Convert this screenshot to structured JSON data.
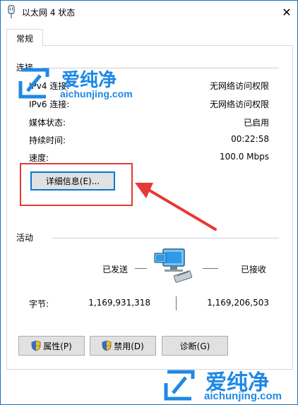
{
  "window": {
    "title": "以太网 4 状态",
    "close": "✕"
  },
  "tabs": [
    {
      "label": "常规"
    }
  ],
  "connection": {
    "section_label": "连接",
    "rows": [
      {
        "label": "IPv4 连接:",
        "value": "无网络访问权限"
      },
      {
        "label": "IPv6 连接:",
        "value": "无网络访问权限"
      },
      {
        "label": "媒体状态:",
        "value": "已启用"
      },
      {
        "label": "持续时间:",
        "value": "00:22:58"
      },
      {
        "label": "速度:",
        "value": "100.0 Mbps"
      }
    ],
    "details_button": "详细信息(E)..."
  },
  "activity": {
    "section_label": "活动",
    "sent_label": "已发送",
    "received_label": "已接收",
    "bytes_label": "字节:",
    "bytes_sent": "1,169,931,318",
    "bytes_received": "1,169,206,503"
  },
  "buttons": {
    "properties": "属性(P)",
    "disable": "禁用(D)",
    "diagnose": "诊断(G)"
  },
  "watermark": {
    "name": "爱纯净",
    "url": "aichunjing.com"
  },
  "colors": {
    "accent": "#0078d7",
    "highlight": "#e53935",
    "watermark": "#1e88e5"
  },
  "icons": {
    "title": "network-adapter-icon",
    "activity": "network-computers-icon",
    "shield": "uac-shield-icon"
  }
}
